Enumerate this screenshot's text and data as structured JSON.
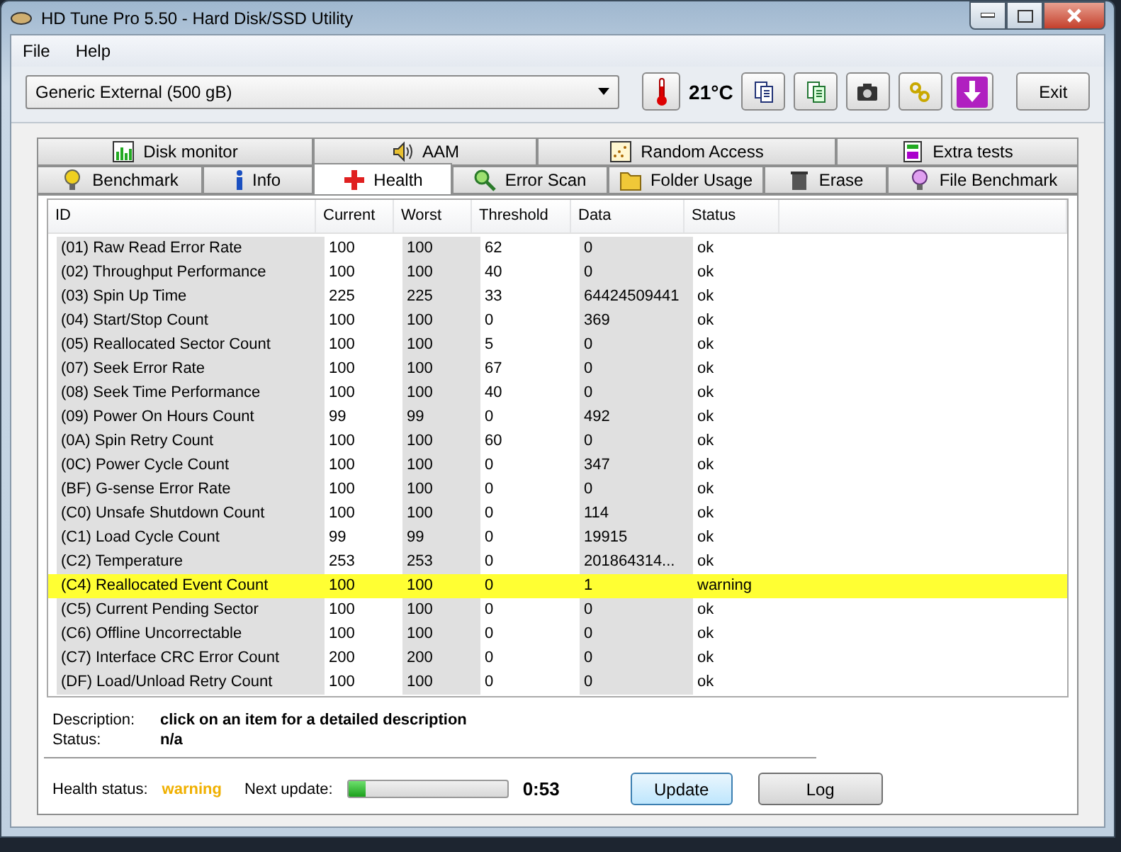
{
  "window": {
    "title": "HD Tune Pro 5.50 - Hard Disk/SSD Utility"
  },
  "menu": [
    "File",
    "Help"
  ],
  "toolbar": {
    "drive": "Generic External (500 gB)",
    "temperature": "21°C",
    "exit": "Exit"
  },
  "tabs_top": [
    {
      "label": "Disk monitor",
      "selected": false
    },
    {
      "label": "AAM",
      "selected": false
    },
    {
      "label": "Random Access",
      "selected": false
    },
    {
      "label": "Extra tests",
      "selected": false
    }
  ],
  "tabs_bottom": [
    {
      "label": "Benchmark",
      "selected": false
    },
    {
      "label": "Info",
      "selected": false
    },
    {
      "label": "Health",
      "selected": true
    },
    {
      "label": "Error Scan",
      "selected": false
    },
    {
      "label": "Folder Usage",
      "selected": false
    },
    {
      "label": "Erase",
      "selected": false
    },
    {
      "label": "File Benchmark",
      "selected": false
    }
  ],
  "table": {
    "columns": [
      "ID",
      "Current",
      "Worst",
      "Threshold",
      "Data",
      "Status"
    ],
    "rows": [
      {
        "cells": [
          "(01) Raw Read Error Rate",
          "100",
          "100",
          "62",
          "0",
          "ok"
        ],
        "highlighted": false
      },
      {
        "cells": [
          "(02) Throughput Performance",
          "100",
          "100",
          "40",
          "0",
          "ok"
        ],
        "highlighted": false
      },
      {
        "cells": [
          "(03) Spin Up Time",
          "225",
          "225",
          "33",
          "64424509441",
          "ok"
        ],
        "highlighted": false
      },
      {
        "cells": [
          "(04) Start/Stop Count",
          "100",
          "100",
          "0",
          "369",
          "ok"
        ],
        "highlighted": false
      },
      {
        "cells": [
          "(05) Reallocated Sector Count",
          "100",
          "100",
          "5",
          "0",
          "ok"
        ],
        "highlighted": false
      },
      {
        "cells": [
          "(07) Seek Error Rate",
          "100",
          "100",
          "67",
          "0",
          "ok"
        ],
        "highlighted": false
      },
      {
        "cells": [
          "(08) Seek Time Performance",
          "100",
          "100",
          "40",
          "0",
          "ok"
        ],
        "highlighted": false
      },
      {
        "cells": [
          "(09) Power On Hours Count",
          "99",
          "99",
          "0",
          "492",
          "ok"
        ],
        "highlighted": false
      },
      {
        "cells": [
          "(0A) Spin Retry Count",
          "100",
          "100",
          "60",
          "0",
          "ok"
        ],
        "highlighted": false
      },
      {
        "cells": [
          "(0C) Power Cycle Count",
          "100",
          "100",
          "0",
          "347",
          "ok"
        ],
        "highlighted": false
      },
      {
        "cells": [
          "(BF) G-sense Error Rate",
          "100",
          "100",
          "0",
          "0",
          "ok"
        ],
        "highlighted": false
      },
      {
        "cells": [
          "(C0) Unsafe Shutdown Count",
          "100",
          "100",
          "0",
          "114",
          "ok"
        ],
        "highlighted": false
      },
      {
        "cells": [
          "(C1) Load Cycle Count",
          "99",
          "99",
          "0",
          "19915",
          "ok"
        ],
        "highlighted": false
      },
      {
        "cells": [
          "(C2) Temperature",
          "253",
          "253",
          "0",
          "201864314...",
          "ok"
        ],
        "highlighted": false
      },
      {
        "cells": [
          "(C4) Reallocated Event Count",
          "100",
          "100",
          "0",
          "1",
          "warning"
        ],
        "highlighted": true
      },
      {
        "cells": [
          "(C5) Current Pending Sector",
          "100",
          "100",
          "0",
          "0",
          "ok"
        ],
        "highlighted": false
      },
      {
        "cells": [
          "(C6) Offline Uncorrectable",
          "100",
          "100",
          "0",
          "0",
          "ok"
        ],
        "highlighted": false
      },
      {
        "cells": [
          "(C7) Interface CRC Error Count",
          "200",
          "200",
          "0",
          "0",
          "ok"
        ],
        "highlighted": false
      },
      {
        "cells": [
          "(DF) Load/Unload Retry Count",
          "100",
          "100",
          "0",
          "0",
          "ok"
        ],
        "highlighted": false
      }
    ]
  },
  "details": [
    {
      "label": "Description:",
      "value": "click on an item for a detailed description"
    },
    {
      "label": "Status:",
      "value": "n/a"
    }
  ],
  "footer": {
    "health_label": "Health status:",
    "health_value": "warning",
    "next_label": "Next update:",
    "level": 0.11,
    "countdown": "0:53",
    "buttons": [
      {
        "label": "Update",
        "selected": true
      },
      {
        "label": "Log",
        "selected": false
      }
    ]
  }
}
